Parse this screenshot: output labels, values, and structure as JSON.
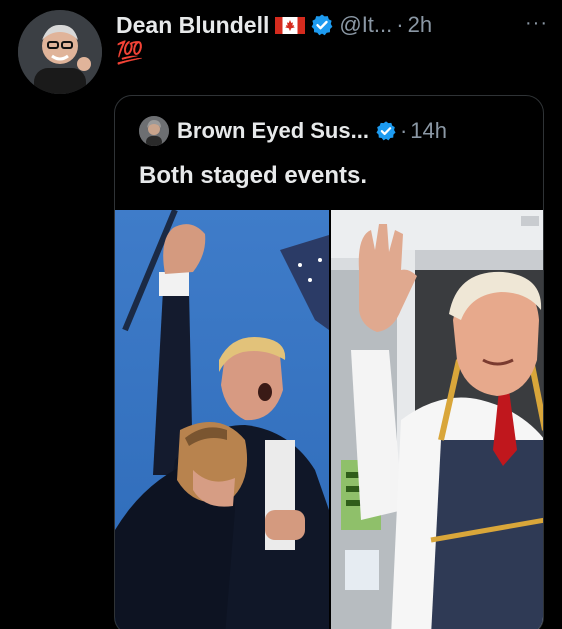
{
  "post": {
    "author_name": "Dean Blundell",
    "author_handle": "@It...",
    "dot": "·",
    "time": "2h",
    "text": "💯",
    "more": "···"
  },
  "quoted_post": {
    "author_name": "Brown Eyed Sus...",
    "dot": "·",
    "time": "14h",
    "text": "Both staged events."
  },
  "icons": {
    "author_flag": "canada-flag-icon",
    "verified": "verified-badge-icon",
    "more": "more-options-icon"
  },
  "colors": {
    "background": "#000000",
    "text": "#e7e9ea",
    "secondary_text": "#8b98a5",
    "verified_blue": "#1d9bf0",
    "border": "#2f3336"
  }
}
